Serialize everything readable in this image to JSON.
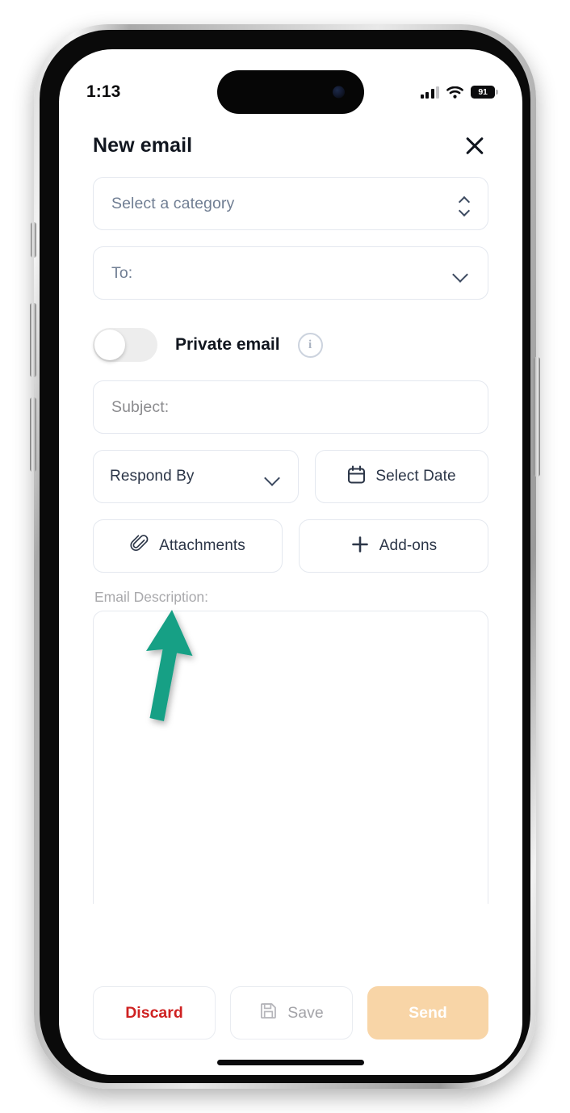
{
  "status_bar": {
    "time": "1:13",
    "signal_icon": "cellular-signal-icon",
    "wifi_icon": "wifi-icon",
    "battery_level": "91",
    "battery_icon": "battery-icon"
  },
  "header": {
    "title": "New email",
    "close_icon": "close-icon"
  },
  "form": {
    "category": {
      "placeholder": "Select a category",
      "icon": "chevron-updown-icon"
    },
    "to": {
      "placeholder": "To:",
      "icon": "chevron-down-icon"
    },
    "private_email": {
      "label": "Private email",
      "state": "off",
      "info_icon": "info-circle-icon",
      "info_glyph": "i"
    },
    "subject": {
      "placeholder": "Subject:"
    },
    "respond_by": {
      "label": "Respond By",
      "icon": "chevron-down-icon"
    },
    "select_date": {
      "label": "Select Date",
      "icon": "calendar-icon"
    },
    "attachments": {
      "label": "Attachments",
      "icon": "paperclip-icon"
    },
    "addons": {
      "label": "Add-ons",
      "icon": "plus-icon"
    },
    "description": {
      "label": "Email Description:",
      "value": ""
    }
  },
  "footer": {
    "discard": "Discard",
    "save": "Save",
    "save_icon": "floppy-disk-icon",
    "send": "Send"
  },
  "annotation": {
    "arrow_icon": "pointer-arrow-icon",
    "arrow_color": "#16a085",
    "points_to": "Attachments"
  },
  "colors": {
    "send_button_bg": "#f8d5a7",
    "discard_text": "#cf2222",
    "field_border": "#e4e8ef",
    "placeholder_text": "#707e93",
    "title_text": "#11161f"
  }
}
